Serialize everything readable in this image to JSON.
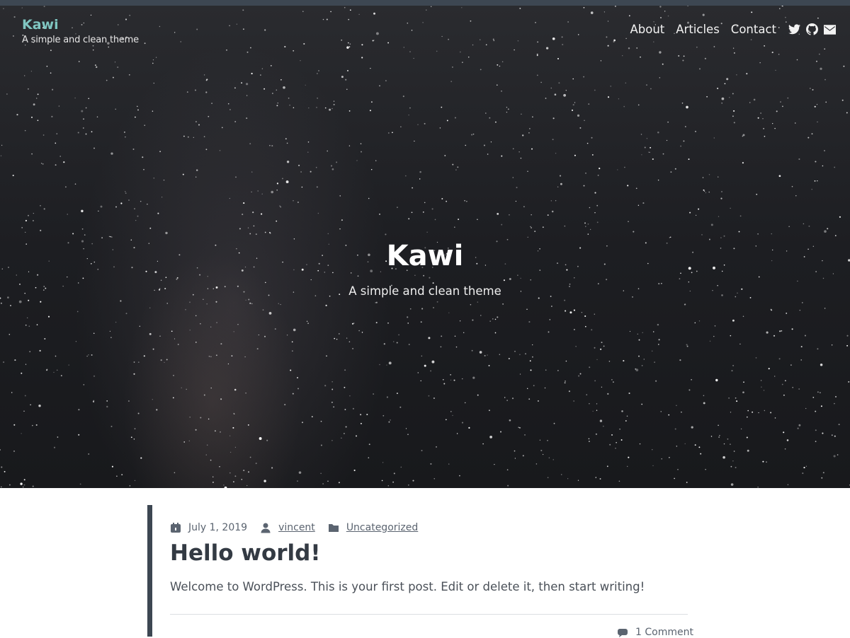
{
  "header": {
    "site_title": "Kawi",
    "tagline": "A simple and clean theme",
    "nav": [
      {
        "label": "About"
      },
      {
        "label": "Articles"
      },
      {
        "label": "Contact"
      }
    ],
    "social_icons": [
      "twitter-icon",
      "github-icon",
      "mail-icon"
    ]
  },
  "hero": {
    "title": "Kawi",
    "tagline": "A simple and clean theme"
  },
  "post": {
    "date": "July 1, 2019",
    "author": "vincent",
    "category": "Uncategorized",
    "title": "Hello world!",
    "excerpt": "Welcome to WordPress. This is your first post. Edit or delete it, then start writing!",
    "comments": "1 Comment"
  },
  "colors": {
    "accent": "#7fc6c1",
    "dark_bar": "#3d4752",
    "text": "#333a43"
  }
}
